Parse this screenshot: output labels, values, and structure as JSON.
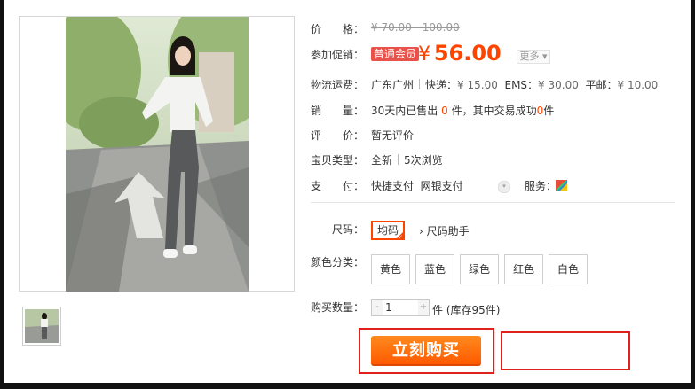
{
  "price": {
    "label": "价　　格：",
    "currency": "¥",
    "original": "70.00 - 100.00"
  },
  "promo": {
    "label": "参加促销：",
    "tag": "普通会员",
    "currency": "¥",
    "value": "56.00",
    "more": "更多"
  },
  "shipping": {
    "label": "物流运费：",
    "location": "广东广州",
    "express_label": "快递：",
    "express": "¥ 15.00",
    "ems_label": "EMS：",
    "ems": "¥ 30.00",
    "post_label": "平邮：",
    "post": "¥ 10.00"
  },
  "sales": {
    "label": "销　　量：",
    "prefix": "30天内已售出",
    "sold": "0",
    "mid": "件，其中交易成功",
    "success": "0",
    "suffix": "件"
  },
  "review": {
    "label": "评　　价：",
    "value": "暂无评价"
  },
  "item_type": {
    "label": "宝贝类型：",
    "condition": "全新",
    "views": "5次浏览"
  },
  "payment": {
    "label": "支　　付：",
    "method1": "快捷支付",
    "method2": "网银支付",
    "service_label": "服务："
  },
  "size": {
    "label": "尺码：",
    "selected": "均码",
    "helper": "尺码助手"
  },
  "colors": {
    "label": "颜色分类：",
    "options": [
      "黄色",
      "蓝色",
      "绿色",
      "红色",
      "白色"
    ]
  },
  "quantity": {
    "label": "购买数量：",
    "minus": "-",
    "value": "1",
    "plus": "+",
    "stock": "件 (库存95件)"
  },
  "buy_button": "立刻购买",
  "accent_color": "#ff4400"
}
